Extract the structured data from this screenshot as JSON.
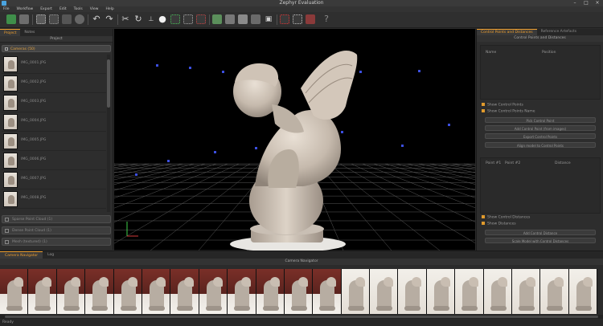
{
  "window": {
    "title": "Zephyr Evaluation",
    "controls": [
      "–",
      "□",
      "×"
    ]
  },
  "menu": [
    "File",
    "Workflow",
    "Export",
    "Edit",
    "Tools",
    "View",
    "Help"
  ],
  "left_panel": {
    "tabs": [
      "Project",
      "Notes"
    ],
    "header": "Project",
    "group_label": "Cameras (50)",
    "cameras": [
      "IMG_0001.JPG",
      "IMG_0002.JPG",
      "IMG_0003.JPG",
      "IMG_0004.JPG",
      "IMG_0005.JPG",
      "IMG_0006.JPG",
      "IMG_0007.JPG",
      "IMG_0008.JPG"
    ],
    "bottom_items": [
      "Sparse Point Cloud (1)",
      "Dense Point Cloud (1)",
      "Mesh (textured) (1)"
    ]
  },
  "right_panel": {
    "tabs": [
      "Control Points and Distances",
      "Reference Artefacts"
    ],
    "header": "Control Points and Distances",
    "cp_columns": [
      "Name",
      "Position"
    ],
    "checks1": [
      "Show Control Points",
      "Show Control Points Name"
    ],
    "buttons1": [
      "Pick Control Point",
      "Add Control Point (from images)",
      "Export Control Points",
      "Align model to Control Points"
    ],
    "dist_columns": [
      "Point #1",
      "Point #2",
      "Distance"
    ],
    "checks2": [
      "Show Control Distances",
      "Show Distances"
    ],
    "buttons2": [
      "Add Control Distance",
      "Scale Model with Control Distances"
    ]
  },
  "bottom": {
    "tabs": [
      "Camera Navigator",
      "Log"
    ],
    "header": "Camera Navigator",
    "frames": 21
  },
  "status": "Ready",
  "colors": {
    "accent": "#f0a030",
    "grid": "#5a5a5a",
    "camera_marker": "#3c4fe0"
  }
}
